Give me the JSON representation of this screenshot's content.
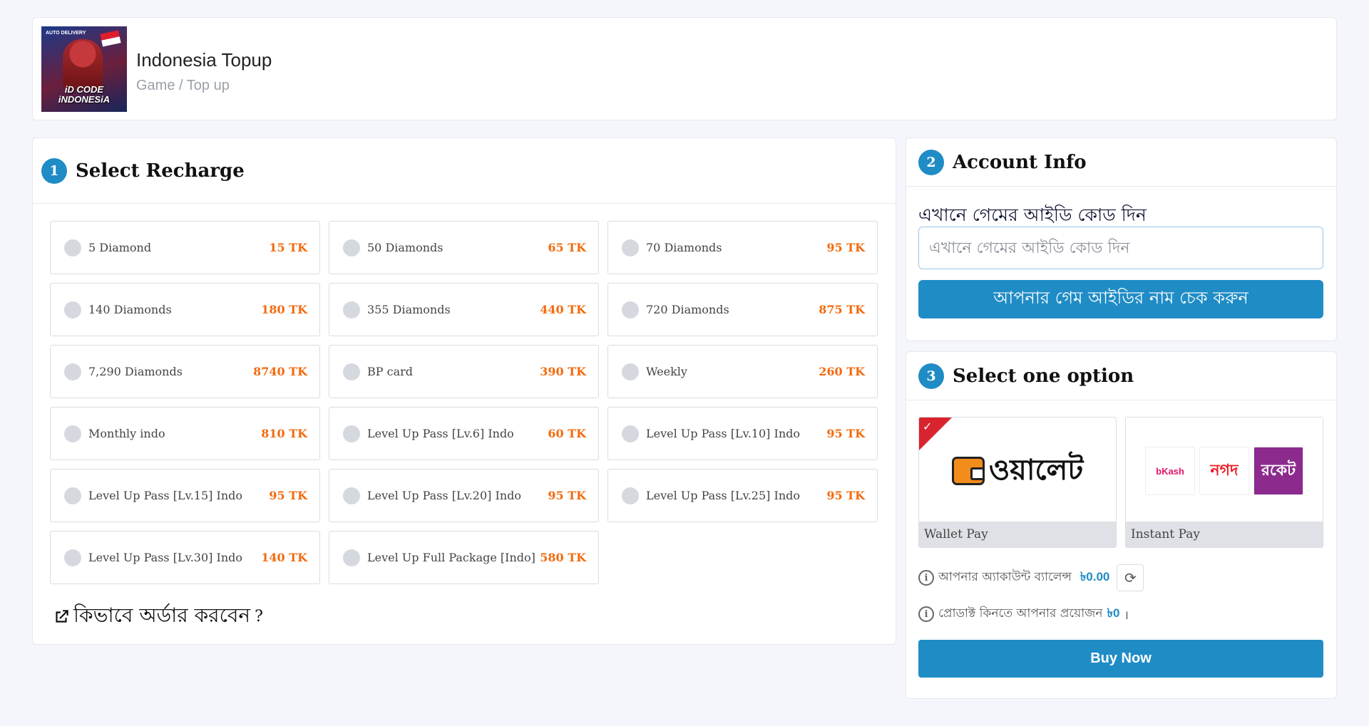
{
  "header": {
    "title": "Indonesia Topup",
    "breadcrumb": "Game / Top up",
    "thumbnail": {
      "badge": "AUTO DELIVERY",
      "caption_line1": "iD CODE",
      "caption_line2": "iNDONESiA"
    }
  },
  "recharge": {
    "step": "1",
    "title": "Select Recharge",
    "options": [
      {
        "label": "5 Diamond",
        "price": "15 TK"
      },
      {
        "label": "50 Diamonds",
        "price": "65 TK"
      },
      {
        "label": "70 Diamonds",
        "price": "95 TK"
      },
      {
        "label": "140 Diamonds",
        "price": "180 TK"
      },
      {
        "label": "355 Diamonds",
        "price": "440 TK"
      },
      {
        "label": "720 Diamonds",
        "price": "875 TK"
      },
      {
        "label": "7,290 Diamonds",
        "price": "8740 TK"
      },
      {
        "label": "BP card",
        "price": "390 TK"
      },
      {
        "label": "Weekly",
        "price": "260 TK"
      },
      {
        "label": "Monthly indo",
        "price": "810 TK"
      },
      {
        "label": "Level Up Pass [Lv.6] Indo",
        "price": "60 TK"
      },
      {
        "label": "Level Up Pass [Lv.10] Indo",
        "price": "95 TK"
      },
      {
        "label": "Level Up Pass [Lv.15] Indo",
        "price": "95 TK"
      },
      {
        "label": "Level Up Pass [Lv.20] Indo",
        "price": "95 TK"
      },
      {
        "label": "Level Up Pass [Lv.25] Indo",
        "price": "95 TK"
      },
      {
        "label": "Level Up Pass [Lv.30] Indo",
        "price": "140 TK"
      },
      {
        "label": "Level Up Full Package [Indo]",
        "price": "580 TK"
      }
    ],
    "howto_label": "কিভাবে অর্ডার করবেন",
    "howto_suffix": "?"
  },
  "account": {
    "step": "2",
    "title": "Account Info",
    "field_label": "এখানে গেমের আইডি কোড দিন",
    "input_placeholder": "এখানে গেমের আইডি কোড দিন",
    "check_button": "আপনার গেম আইডির নাম চেক করুন"
  },
  "payment": {
    "step": "3",
    "title": "Select one option",
    "methods": [
      {
        "label": "Wallet Pay",
        "logo_text": "ওয়ালেট",
        "selected": true,
        "icon": "wallet-icon"
      },
      {
        "label": "Instant Pay",
        "logos": [
          "bKash",
          "নগদ",
          "রকেট"
        ],
        "selected": false
      }
    ],
    "balance_text": "আপনার অ্যাকাউন্ট ব্যালেন্স",
    "balance_amount": "৳0.00",
    "required_text": "প্রোডাক্ট কিনতে আপনার প্রয়োজন",
    "required_amount": "৳0",
    "required_suffix": "।",
    "buy_button": "Buy Now"
  },
  "colors": {
    "accent": "#1f8cc6",
    "price": "#f26a0d",
    "selected_corner": "#d9232e"
  }
}
